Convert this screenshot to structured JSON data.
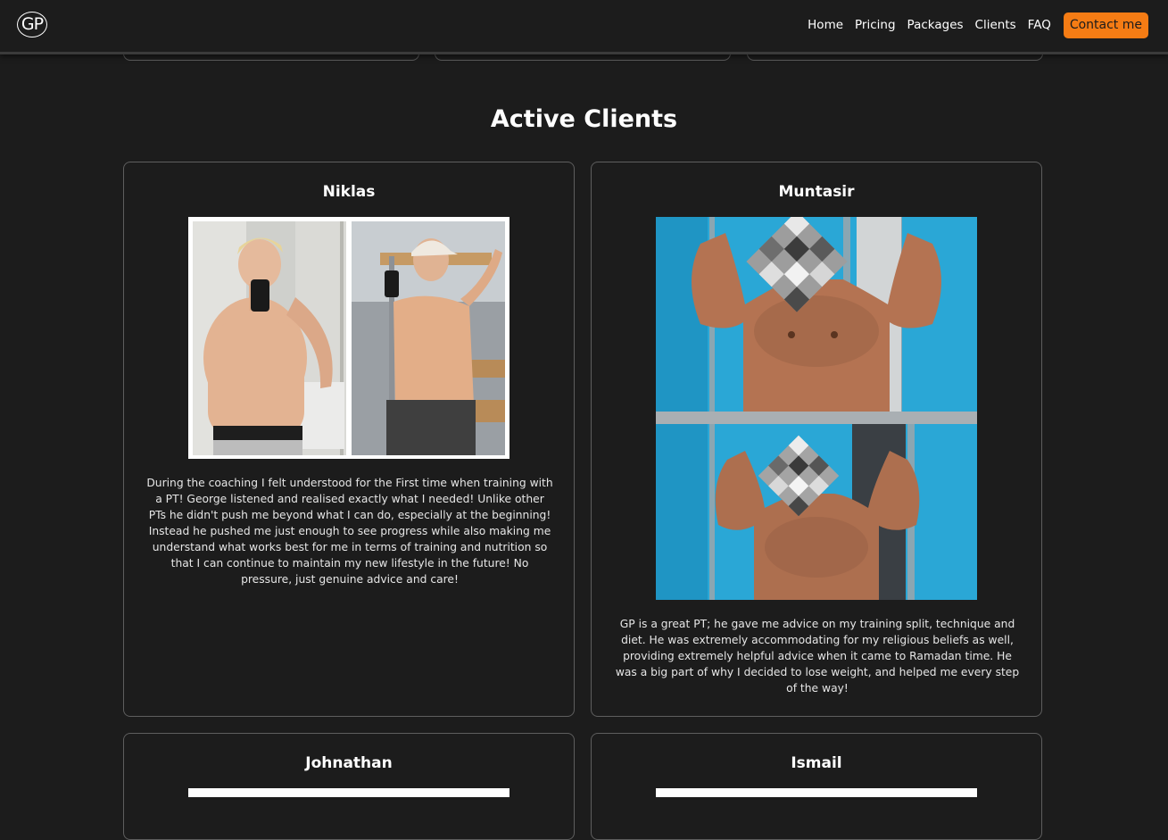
{
  "nav": {
    "logo": "GP",
    "links": [
      "Home",
      "Pricing",
      "Packages",
      "Clients",
      "FAQ"
    ],
    "contact": "Contact me"
  },
  "section": {
    "title": "Active Clients"
  },
  "clients": [
    {
      "name": "Niklas",
      "testimonial": "During the coaching I felt understood for the First time when training with a PT! George listened and realised exactly what I needed! Unlike other PTs he didn't push me beyond what I can do, especially at the beginning! Instead he pushed me just enough to see progress while also making me understand what works best for me in terms of training and nutrition so that I can continue to maintain my new lifestyle in the future! No pressure, just genuine advice and care!"
    },
    {
      "name": "Muntasir",
      "testimonial": "GP is a great PT; he gave me advice on my training split, technique and diet. He was extremely accommodating for my religious beliefs as well, providing extremely helpful advice when it came to Ramadan time. He was a big part of why I decided to lose weight, and helped me every step of the way!"
    },
    {
      "name": "Johnathan"
    },
    {
      "name": "Ismail"
    }
  ],
  "colors": {
    "background": "#1c1c1c",
    "accent": "#f57c14",
    "card_border": "#5e5e5e",
    "locker_blue": "#2aa7d6"
  }
}
